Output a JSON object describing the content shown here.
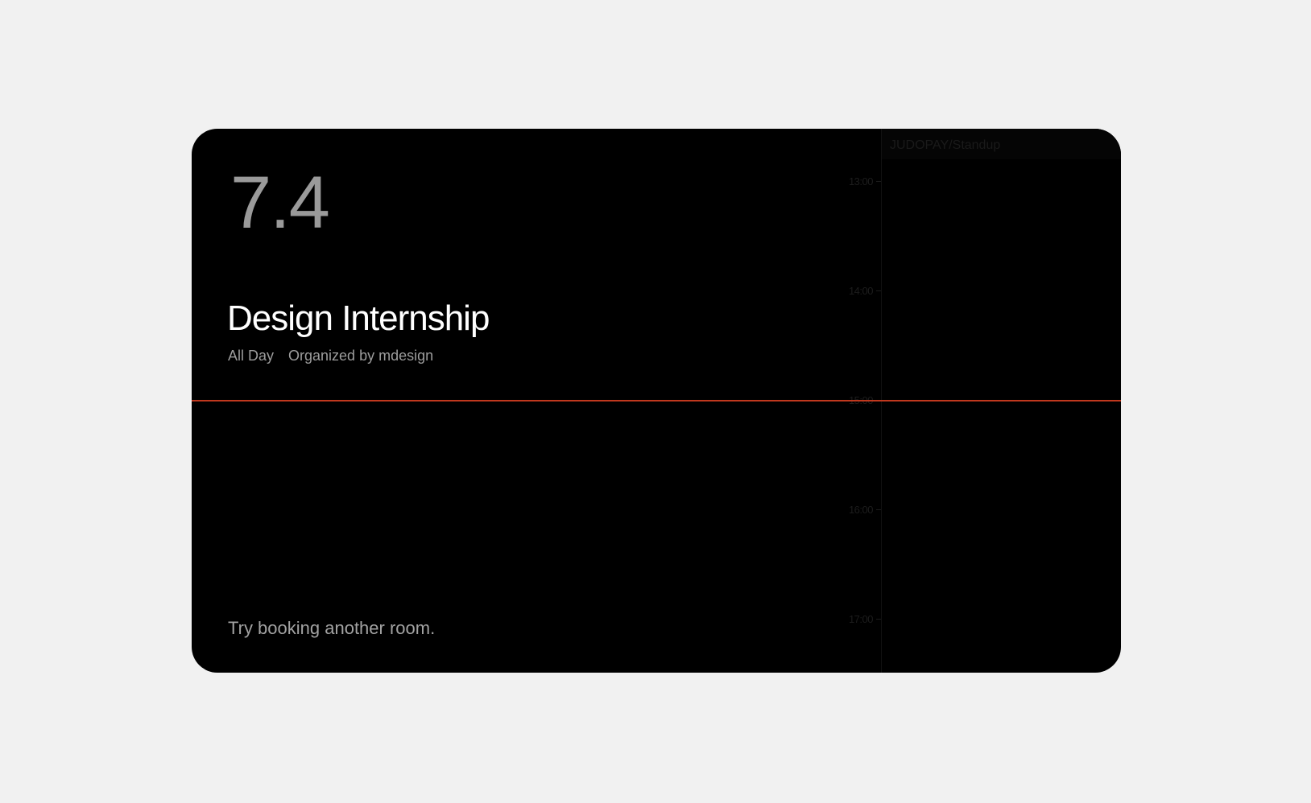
{
  "date": "7.4",
  "event": {
    "title": "Design Internship",
    "duration": "All Day",
    "organizer": "Organized by mdesign"
  },
  "footer": {
    "message": "Try booking another room."
  },
  "timeline": {
    "hours": [
      "13:00",
      "14:00",
      "15:00",
      "16:00",
      "17:00"
    ],
    "events": [
      {
        "title": "JUDOPAY/Standup"
      }
    ]
  },
  "colors": {
    "background": "#f1f1f1",
    "panel": "#000000",
    "now_line": "#c0381e"
  }
}
